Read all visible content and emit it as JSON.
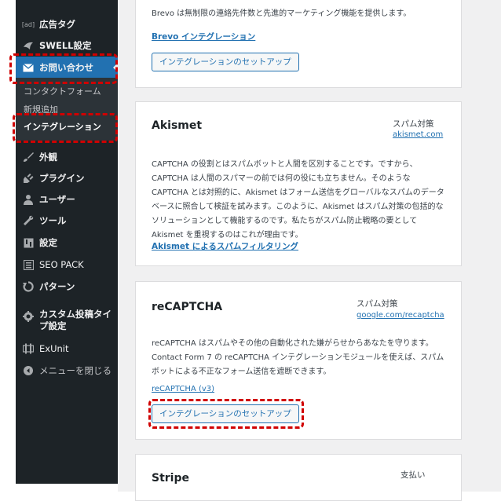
{
  "sidebar": {
    "items": [
      {
        "label": "広告タグ",
        "icon": "ad-icon"
      },
      {
        "label": "SWELL設定",
        "icon": "swell-icon"
      },
      {
        "label": "お問い合わせ",
        "icon": "mail-icon"
      },
      {
        "label": "外観",
        "icon": "paintbrush-icon"
      },
      {
        "label": "プラグイン",
        "icon": "plugin-icon"
      },
      {
        "label": "ユーザー",
        "icon": "user-icon"
      },
      {
        "label": "ツール",
        "icon": "wrench-icon"
      },
      {
        "label": "設定",
        "icon": "settings-icon"
      },
      {
        "label": "SEO PACK",
        "icon": "seo-pack-icon"
      },
      {
        "label": "パターン",
        "icon": "pattern-icon"
      },
      {
        "label": "カスタム投稿タイプ設定",
        "icon": "gear-icon"
      },
      {
        "label": "ExUnit",
        "icon": "exunit-icon"
      },
      {
        "label": "メニューを閉じる",
        "icon": "collapse-icon"
      }
    ],
    "ad_icon_text": "[ad]",
    "submenu": [
      {
        "label": "コンタクトフォーム"
      },
      {
        "label": "新規追加"
      },
      {
        "label": "インテグレーション"
      }
    ]
  },
  "cards": {
    "brevo": {
      "description": "Brevo は無制限の連絡先件数と先進的マーケティング機能を提供します。",
      "doc_link": "Brevo インテグレーション",
      "button": "インテグレーションのセットアップ"
    },
    "akismet": {
      "title": "Akismet",
      "category": "スパム対策",
      "link": "akismet.com",
      "description": "CAPTCHA の役割とはスパムボットと人間を区別することです。ですから、CAPTCHA は人間のスパマーの前では何の役にも立ちません。そのような CAPTCHA とは対照的に、Akismet はフォーム送信をグローバルなスパムのデータベースに照合して検証を試みます。このように、Akismet はスパム対策の包括的なソリューションとして機能するのです。私たちがスパム防止戦略の要として Akismet を重視するのはこれが理由です。",
      "doc_link": "Akismet によるスパムフィルタリング"
    },
    "recaptcha": {
      "title": "reCAPTCHA",
      "category": "スパム対策",
      "link": "google.com/recaptcha",
      "description": "reCAPTCHA はスパムやその他の自動化された嫌がらせからあなたを守ります。Contact Form 7 の reCAPTCHA インテグレーションモジュールを使えば、スパムボットによる不正なフォーム送信を遮断できます。",
      "doc_link": "reCAPTCHA (v3)",
      "button": "インテグレーションのセットアップ"
    },
    "stripe": {
      "title": "Stripe",
      "category": "支払い"
    }
  },
  "colors": {
    "sidebar_bg": "#1d2327",
    "active_bg": "#2271b1",
    "link": "#2271b1",
    "annotation": "#d00000"
  }
}
